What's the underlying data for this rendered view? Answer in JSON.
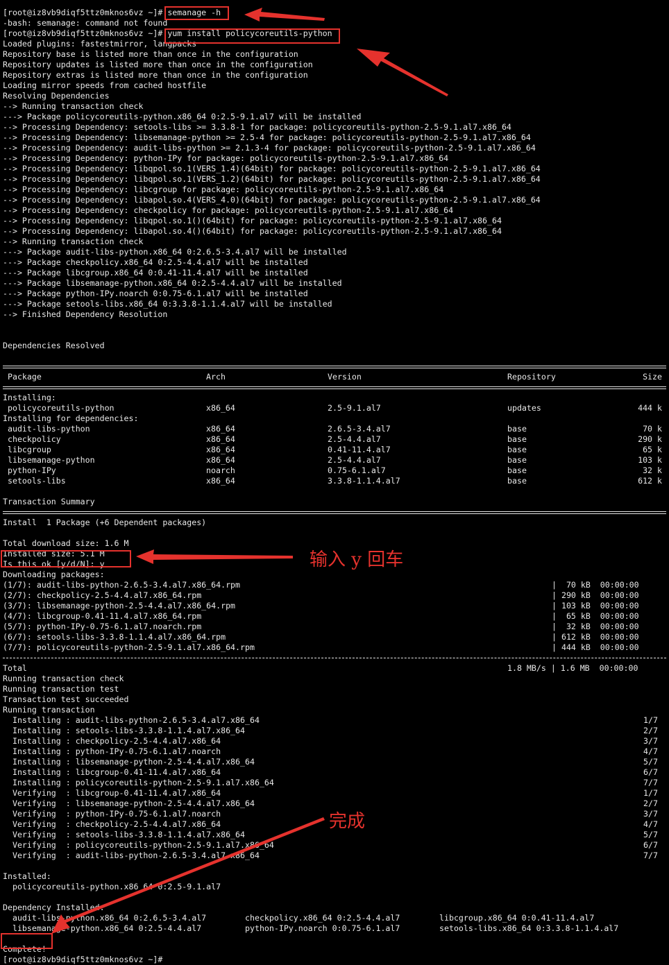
{
  "prompt": "[root@iz8vb9diqf5ttz0mknos6vz ~]# ",
  "pre_lines": [
    "[root@iz8vb9diqf5ttz0mknos6vz ~]# semanage -h",
    "-bash: semanage: command not found",
    "[root@iz8vb9diqf5ttz0mknos6vz ~]# yum install policycoreutils-python",
    "Loaded plugins: fastestmirror, langpacks",
    "Repository base is listed more than once in the configuration",
    "Repository updates is listed more than once in the configuration",
    "Repository extras is listed more than once in the configuration",
    "Loading mirror speeds from cached hostfile",
    "Resolving Dependencies",
    "--> Running transaction check",
    "---> Package policycoreutils-python.x86_64 0:2.5-9.1.al7 will be installed",
    "--> Processing Dependency: setools-libs >= 3.3.8-1 for package: policycoreutils-python-2.5-9.1.al7.x86_64",
    "--> Processing Dependency: libsemanage-python >= 2.5-4 for package: policycoreutils-python-2.5-9.1.al7.x86_64",
    "--> Processing Dependency: audit-libs-python >= 2.1.3-4 for package: policycoreutils-python-2.5-9.1.al7.x86_64",
    "--> Processing Dependency: python-IPy for package: policycoreutils-python-2.5-9.1.al7.x86_64",
    "--> Processing Dependency: libqpol.so.1(VERS_1.4)(64bit) for package: policycoreutils-python-2.5-9.1.al7.x86_64",
    "--> Processing Dependency: libqpol.so.1(VERS_1.2)(64bit) for package: policycoreutils-python-2.5-9.1.al7.x86_64",
    "--> Processing Dependency: libcgroup for package: policycoreutils-python-2.5-9.1.al7.x86_64",
    "--> Processing Dependency: libapol.so.4(VERS_4.0)(64bit) for package: policycoreutils-python-2.5-9.1.al7.x86_64",
    "--> Processing Dependency: checkpolicy for package: policycoreutils-python-2.5-9.1.al7.x86_64",
    "--> Processing Dependency: libqpol.so.1()(64bit) for package: policycoreutils-python-2.5-9.1.al7.x86_64",
    "--> Processing Dependency: libapol.so.4()(64bit) for package: policycoreutils-python-2.5-9.1.al7.x86_64",
    "--> Running transaction check",
    "---> Package audit-libs-python.x86_64 0:2.6.5-3.4.al7 will be installed",
    "---> Package checkpolicy.x86_64 0:2.5-4.4.al7 will be installed",
    "---> Package libcgroup.x86_64 0:0.41-11.4.al7 will be installed",
    "---> Package libsemanage-python.x86_64 0:2.5-4.4.al7 will be installed",
    "---> Package python-IPy.noarch 0:0.75-6.1.al7 will be installed",
    "---> Package setools-libs.x86_64 0:3.3.8-1.1.4.al7 will be installed",
    "--> Finished Dependency Resolution",
    "",
    "",
    "Dependencies Resolved",
    ""
  ],
  "pkg_table": {
    "headers": [
      "Package",
      "Arch",
      "Version",
      "Repository",
      "Size"
    ],
    "installing_label": "Installing:",
    "installing": [
      [
        "policycoreutils-python",
        "x86_64",
        "2.5-9.1.al7",
        "updates",
        "444 k"
      ]
    ],
    "deps_label": "Installing for dependencies:",
    "deps": [
      [
        "audit-libs-python",
        "x86_64",
        "2.6.5-3.4.al7",
        "base",
        "70 k"
      ],
      [
        "checkpolicy",
        "x86_64",
        "2.5-4.4.al7",
        "base",
        "290 k"
      ],
      [
        "libcgroup",
        "x86_64",
        "0.41-11.4.al7",
        "base",
        "65 k"
      ],
      [
        "libsemanage-python",
        "x86_64",
        "2.5-4.4.al7",
        "base",
        "103 k"
      ],
      [
        "python-IPy",
        "noarch",
        "0.75-6.1.al7",
        "base",
        "32 k"
      ],
      [
        "setools-libs",
        "x86_64",
        "3.3.8-1.1.4.al7",
        "base",
        "612 k"
      ]
    ],
    "summary_title": "Transaction Summary",
    "install_summary": "Install  1 Package (+6 Dependent packages)",
    "download_size": "Total download size: 1.6 M",
    "installed_size": "Installed size: 5.1 M",
    "confirm": "Is this ok [y/d/N]: y",
    "downloading_label": "Downloading packages:"
  },
  "downloads": [
    [
      "(1/7): audit-libs-python-2.6.5-3.4.al7.x86_64.rpm",
      "|  70 kB  00:00:00"
    ],
    [
      "(2/7): checkpolicy-2.5-4.4.al7.x86_64.rpm",
      "| 290 kB  00:00:00"
    ],
    [
      "(3/7): libsemanage-python-2.5-4.4.al7.x86_64.rpm",
      "| 103 kB  00:00:00"
    ],
    [
      "(4/7): libcgroup-0.41-11.4.al7.x86_64.rpm",
      "|  65 kB  00:00:00"
    ],
    [
      "(5/7): python-IPy-0.75-6.1.al7.noarch.rpm",
      "|  32 kB  00:00:00"
    ],
    [
      "(6/7): setools-libs-3.3.8-1.1.4.al7.x86_64.rpm",
      "| 612 kB  00:00:00"
    ],
    [
      "(7/7): policycoreutils-python-2.5-9.1.al7.x86_64.rpm",
      "| 444 kB  00:00:00"
    ]
  ],
  "total": [
    "Total",
    "1.8 MB/s | 1.6 MB  00:00:00"
  ],
  "transaction_lines": [
    "Running transaction check",
    "Running transaction test",
    "Transaction test succeeded",
    "Running transaction"
  ],
  "steps": [
    [
      "  Installing : audit-libs-python-2.6.5-3.4.al7.x86_64",
      "1/7"
    ],
    [
      "  Installing : setools-libs-3.3.8-1.1.4.al7.x86_64",
      "2/7"
    ],
    [
      "  Installing : checkpolicy-2.5-4.4.al7.x86_64",
      "3/7"
    ],
    [
      "  Installing : python-IPy-0.75-6.1.al7.noarch",
      "4/7"
    ],
    [
      "  Installing : libsemanage-python-2.5-4.4.al7.x86_64",
      "5/7"
    ],
    [
      "  Installing : libcgroup-0.41-11.4.al7.x86_64",
      "6/7"
    ],
    [
      "  Installing : policycoreutils-python-2.5-9.1.al7.x86_64",
      "7/7"
    ],
    [
      "  Verifying  : libcgroup-0.41-11.4.al7.x86_64",
      "1/7"
    ],
    [
      "  Verifying  : libsemanage-python-2.5-4.4.al7.x86_64",
      "2/7"
    ],
    [
      "  Verifying  : python-IPy-0.75-6.1.al7.noarch",
      "3/7"
    ],
    [
      "  Verifying  : checkpolicy-2.5-4.4.al7.x86_64",
      "4/7"
    ],
    [
      "  Verifying  : setools-libs-3.3.8-1.1.4.al7.x86_64",
      "5/7"
    ],
    [
      "  Verifying  : policycoreutils-python-2.5-9.1.al7.x86_64",
      "6/7"
    ],
    [
      "  Verifying  : audit-libs-python-2.6.5-3.4.al7.x86_64",
      "7/7"
    ]
  ],
  "installed_label": "Installed:",
  "installed_pkg": "  policycoreutils-python.x86_64 0:2.5-9.1.al7",
  "dep_installed_label": "Dependency Installed:",
  "dep_installed": [
    [
      "  audit-libs-python.x86_64 0:2.6.5-3.4.al7",
      "checkpolicy.x86_64 0:2.5-4.4.al7",
      "libcgroup.x86_64 0:0.41-11.4.al7"
    ],
    [
      "  libsemanage-python.x86_64 0:2.5-4.4.al7",
      "python-IPy.noarch 0:0.75-6.1.al7",
      "setools-libs.x86_64 0:3.3.8-1.1.4.al7"
    ]
  ],
  "complete": "Complete!",
  "final_prompt": "[root@iz8vb9diqf5ttz0mknos6vz ~]#",
  "annotations": {
    "enter_y": "输入 y 回车",
    "done": "完成"
  },
  "colors": {
    "background": "#000000",
    "text": "#e8e8e8",
    "highlight": "#e5322d"
  }
}
